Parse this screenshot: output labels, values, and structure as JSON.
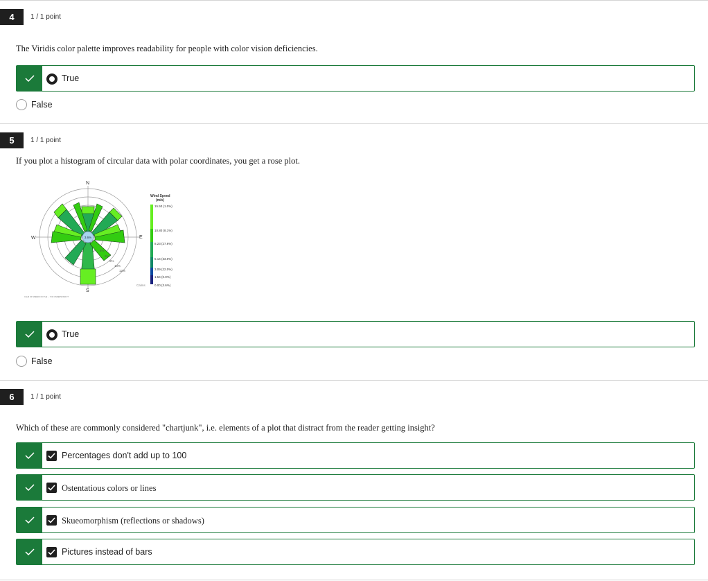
{
  "questions": [
    {
      "number": "4",
      "points": "1 / 1 point",
      "prompt": "The Viridis color palette improves readability for people with color vision deficiencies.",
      "selected": "True",
      "other": "False"
    },
    {
      "number": "5",
      "points": "1 / 1 point",
      "prompt": "If you plot a histogram of circular data with polar coordinates, you get a rose plot.",
      "selected": "True",
      "other": "False",
      "figure": {
        "compass": {
          "n": "N",
          "e": "E",
          "s": "S",
          "w": "W"
        },
        "rings": [
          "4%",
          "6%",
          "8%",
          "10%",
          "12%"
        ],
        "calm_center": "3.6%",
        "legend_title": "Wind Speed",
        "legend_unit": "(m/s)",
        "legend": [
          "15.50 (1.0%)",
          "10.80 (8.1%)",
          "8.23 (27.6%)",
          "5.14 (33.0%)",
          "3.09 (22.0%)",
          "1.54 (0.0%)",
          "0.00 (3.6%)"
        ],
        "calms": "Calms",
        "legend_colors": [
          "#66ee22",
          "#33cc11",
          "#22aa55",
          "#118866",
          "#0b4aa0",
          "#1a237e"
        ],
        "footer": "CALM OF SPEEDS ON THE ... YOU UNDERSTAND IT"
      }
    },
    {
      "number": "6",
      "points": "1 / 1 point",
      "prompt": "Which of these are commonly considered \"chartjunk\", i.e. elements of a plot that distract from the reader getting insight?",
      "choices": [
        "Percentages don't add up to 100",
        "Ostentatious colors or lines",
        "Skueomorphism (reflections or shadows)",
        "Pictures instead of bars"
      ]
    }
  ],
  "colors": {
    "correct": "#1b7a3a",
    "badge": "#1f1f1f"
  }
}
